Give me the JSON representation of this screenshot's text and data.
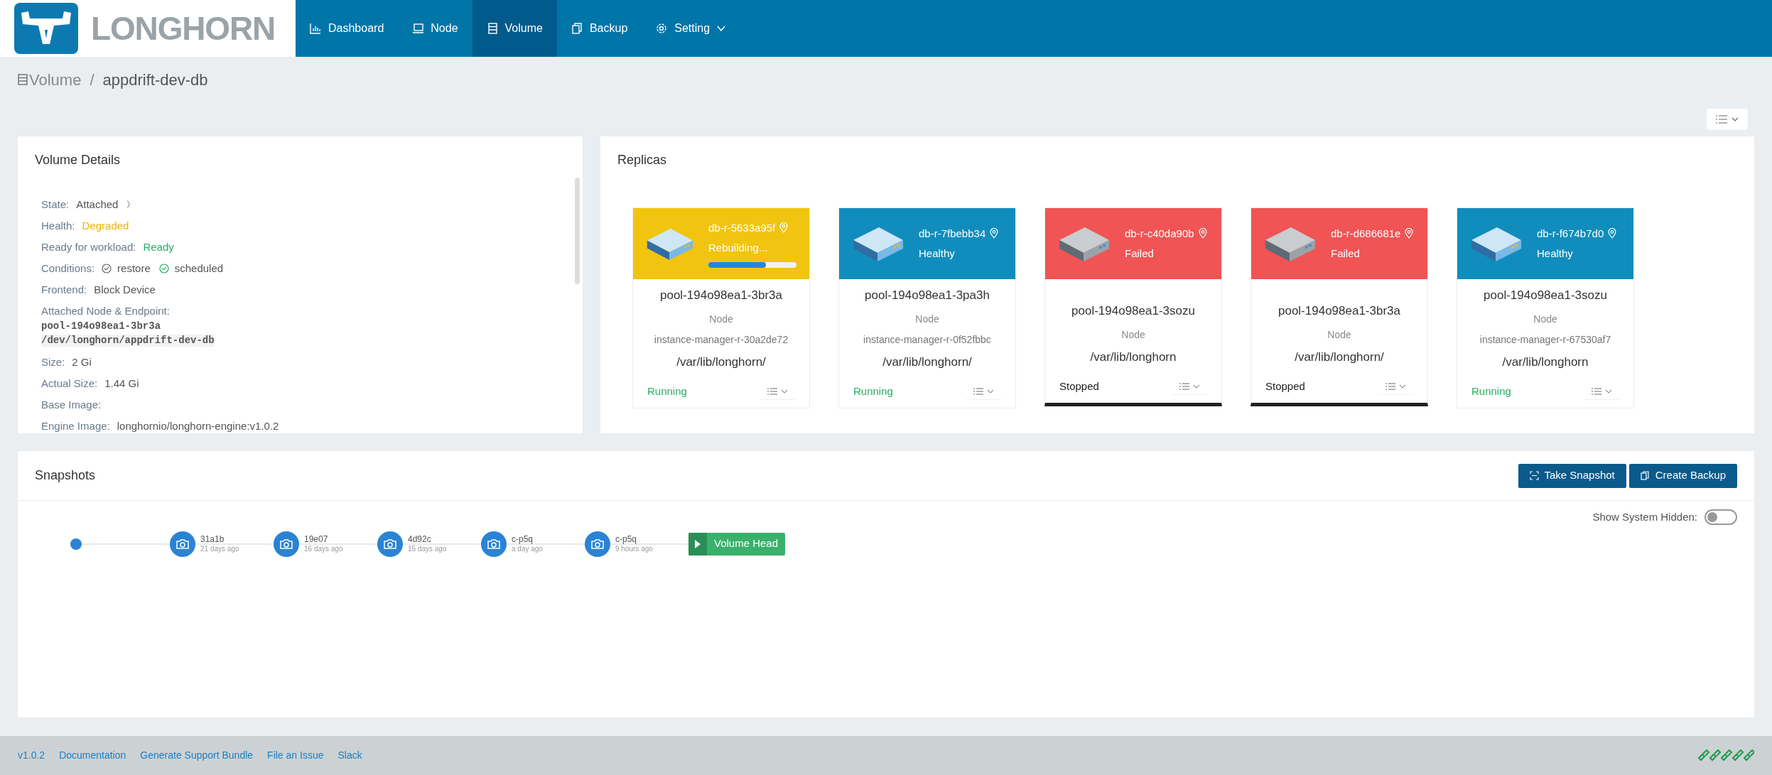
{
  "header": {
    "logo": "LONGHORN",
    "nav": [
      {
        "label": "Dashboard",
        "selected": false
      },
      {
        "label": "Node",
        "selected": false
      },
      {
        "label": "Volume",
        "selected": true
      },
      {
        "label": "Backup",
        "selected": false
      },
      {
        "label": "Setting",
        "selected": false,
        "dropdown": true
      }
    ]
  },
  "breadcrumb": {
    "parent": "Volume",
    "separator": "/",
    "current": "appdrift-dev-db"
  },
  "volume_details": {
    "title": "Volume Details",
    "fields": [
      {
        "kind": "text",
        "label": "State:",
        "value": "Attached",
        "busy": true
      },
      {
        "kind": "text",
        "label": "Health:",
        "value": "Degraded",
        "color": "#e9b600"
      },
      {
        "kind": "text",
        "label": "Ready for workload:",
        "value": "Ready",
        "color": "#27ae60"
      },
      {
        "kind": "conditions",
        "label": "Conditions:",
        "items": [
          {
            "label": "restore",
            "ok": false
          },
          {
            "label": "scheduled",
            "ok": true
          }
        ]
      },
      {
        "kind": "text",
        "label": "Frontend:",
        "value": "Block Device"
      },
      {
        "kind": "endpoint",
        "label": "Attached Node & Endpoint:",
        "node": "pool-194o98ea1-3br3a",
        "endpoint": "/dev/longhorn/appdrift-dev-db"
      },
      {
        "kind": "text",
        "label": "Size:",
        "value": "2 Gi"
      },
      {
        "kind": "text",
        "label": "Actual Size:",
        "value": "1.44 Gi"
      },
      {
        "kind": "text",
        "label": "Base Image:"
      },
      {
        "kind": "text",
        "label": "Engine Image:",
        "value": "longhornio/longhorn-engine:v1.0.2"
      }
    ]
  },
  "replicas": {
    "title": "Replicas",
    "items": [
      {
        "kind": "rebuilding",
        "name": "db-r-5633a95f",
        "status": "Rebuilding...",
        "level": 0.65,
        "node": "pool-194o98ea1-3br3a",
        "node_label": "Node",
        "instance_manager": "instance-manager-r-30a2de72",
        "path": "/var/lib/longhorn/",
        "state": "Running",
        "running": true
      },
      {
        "kind": "healthy",
        "name": "db-r-7fbebb34",
        "status": "Healthy",
        "node": "pool-194o98ea1-3pa3h",
        "node_label": "Node",
        "instance_manager": "instance-manager-r-0f52fbbc",
        "path": "/var/lib/longhorn/",
        "state": "Running",
        "running": true
      },
      {
        "kind": "failed",
        "name": "db-r-c40da90b",
        "status": "Failed",
        "node": "pool-194o98ea1-3sozu",
        "node_label": "Node",
        "path": "/var/lib/longhorn",
        "state": "Stopped",
        "running": false
      },
      {
        "kind": "failed",
        "name": "db-r-d686681e",
        "status": "Failed",
        "node": "pool-194o98ea1-3br3a",
        "node_label": "Node",
        "path": "/var/lib/longhorn/",
        "state": "Stopped",
        "running": false
      },
      {
        "kind": "healthy",
        "name": "db-r-f674b7d0",
        "status": "Healthy",
        "node": "pool-194o98ea1-3sozu",
        "node_label": "Node",
        "instance_manager": "instance-manager-r-67530af7",
        "path": "/var/lib/longhorn",
        "state": "Running",
        "running": true
      }
    ]
  },
  "snapshots": {
    "title": "Snapshots",
    "buttons": [
      "Take Snapshot",
      "Create Backup"
    ],
    "show_system_hidden": {
      "label": "Show System Hidden:",
      "on": false
    },
    "items": [
      {
        "kind": "root"
      },
      {
        "kind": "snapshot",
        "name": "31a1b",
        "age": "21 days ago"
      },
      {
        "kind": "snapshot",
        "name": "19e07",
        "age": "16 days ago"
      },
      {
        "kind": "snapshot",
        "name": "4d92c",
        "age": "15 days ago"
      },
      {
        "kind": "snapshot",
        "name": "c-p5q",
        "age": "a day ago"
      },
      {
        "kind": "snapshot",
        "name": "c-p5q",
        "age": "9 hours ago"
      },
      {
        "kind": "head",
        "name": "Volume Head"
      }
    ]
  },
  "footer": {
    "links": [
      "v1.0.2",
      "Documentation",
      "Generate Support Bundle",
      "File an Issue",
      "Slack"
    ]
  }
}
